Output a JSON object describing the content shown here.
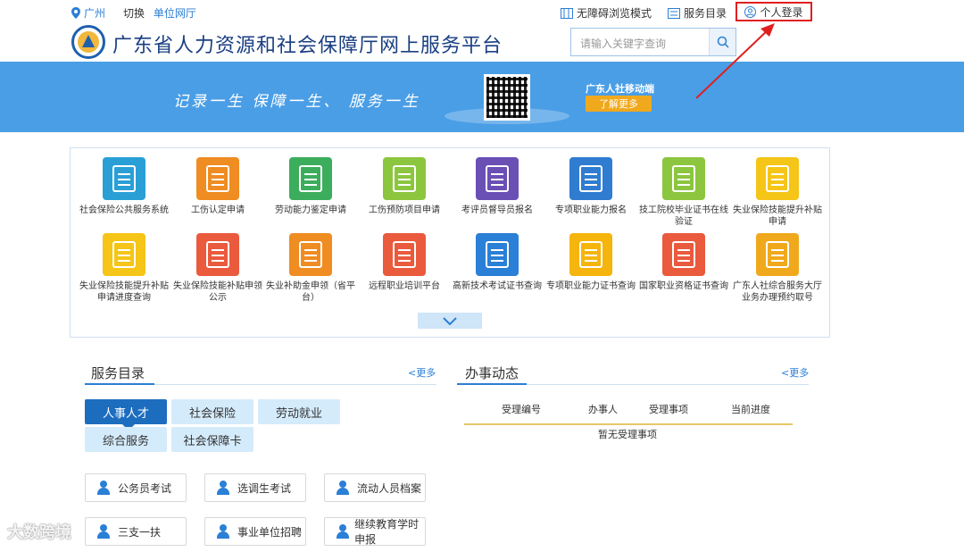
{
  "topbar": {
    "location": "广州",
    "switch_label": "切换",
    "unit_link": "单位网厅",
    "accessibility": "无障碍浏览模式",
    "service_catalog": "服务目录",
    "login": "个人登录"
  },
  "header": {
    "title": "广东省人力资源和社会保障厅网上服务平台",
    "search_placeholder": "请输入关键字查询"
  },
  "banner": {
    "slogan": "记录一生  保障一生、 服务一生",
    "mobile_label": "广东人社移动端",
    "more_button": "了解更多"
  },
  "services": [
    {
      "label": "社会保险公共服务系统",
      "color": "#2a9fd6"
    },
    {
      "label": "工伤认定申请",
      "color": "#ef8c22"
    },
    {
      "label": "劳动能力鉴定申请",
      "color": "#3cad5c"
    },
    {
      "label": "工伤预防项目申请",
      "color": "#8cc63f"
    },
    {
      "label": "考评员督导员报名",
      "color": "#6a4fb5"
    },
    {
      "label": "专项职业能力报名",
      "color": "#2f7cd1"
    },
    {
      "label": "技工院校毕业证书在线验证",
      "color": "#8cc63f"
    },
    {
      "label": "失业保险技能提升补贴申请",
      "color": "#f5c518"
    },
    {
      "label": "失业保险技能提升补贴申请进度查询",
      "color": "#f5c518"
    },
    {
      "label": "失业保险技能补贴申领公示",
      "color": "#ea5a3d"
    },
    {
      "label": "失业补助金申领（省平台）",
      "color": "#ef8c22"
    },
    {
      "label": "远程职业培训平台",
      "color": "#ea5a3d"
    },
    {
      "label": "高新技术考试证书查询",
      "color": "#2a7fd6"
    },
    {
      "label": "专项职业能力证书查询",
      "color": "#f5b50c"
    },
    {
      "label": "国家职业资格证书查询",
      "color": "#ea5a3d"
    },
    {
      "label": "广东人社综合服务大厅业务办理预约取号",
      "color": "#f0a91d"
    }
  ],
  "catalog": {
    "heading": "服务目录",
    "more": "<更多",
    "tabs": [
      "人事人才",
      "社会保险",
      "劳动就业",
      "综合服务",
      "社会保障卡"
    ],
    "quick_links": [
      "公务员考试",
      "选调生考试",
      "流动人员档案",
      "三支一扶",
      "事业单位招聘",
      "继续教育学时申报"
    ]
  },
  "news": {
    "heading": "办事动态",
    "more": "<更多",
    "columns": [
      "受理编号",
      "办事人",
      "受理事项",
      "当前进度"
    ],
    "empty": "暂无受理事项"
  },
  "watermark": "大数跨境"
}
